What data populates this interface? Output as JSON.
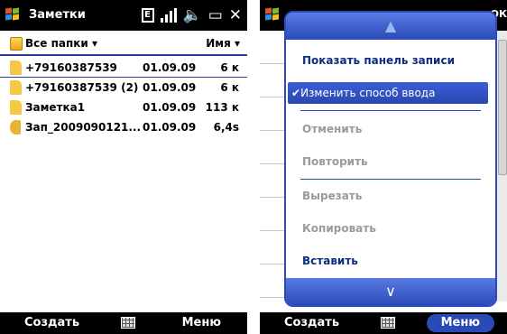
{
  "left_screen": {
    "app_title": "Заметки",
    "status_icons": [
      "edge-icon",
      "signal-icon",
      "volume-icon",
      "battery-icon",
      "close-icon"
    ],
    "status_e": "E",
    "folder": {
      "label": "Все папки",
      "sort_label": "Имя"
    },
    "files": [
      {
        "name": "+79160387539",
        "date": "01.09.09",
        "size": "6 к",
        "icon": "note-file-icon"
      },
      {
        "name": "+79160387539 (2)",
        "date": "01.09.09",
        "size": "6 к",
        "icon": "note-file-icon"
      },
      {
        "name": "Заметка1",
        "date": "01.09.09",
        "size": "113 к",
        "icon": "note-file-icon"
      },
      {
        "name": "Зап_2009090121...",
        "date": "01.09.09",
        "size": "6,4s",
        "icon": "sound-file-icon"
      }
    ],
    "softkeys": {
      "left": "Создать",
      "right": "Меню"
    }
  },
  "right_screen": {
    "ok_label": "ОК",
    "menu_items": [
      {
        "label": "Показать панель записи",
        "state": "enabled"
      },
      {
        "label": "Изменить способ ввода",
        "state": "selected",
        "checked": true
      },
      {
        "label": "Отменить",
        "state": "disabled"
      },
      {
        "label": "Повторить",
        "state": "disabled"
      },
      {
        "label": "Вырезать",
        "state": "disabled"
      },
      {
        "label": "Копировать",
        "state": "disabled"
      },
      {
        "label": "Вставить",
        "state": "enabled"
      }
    ],
    "softkeys": {
      "left": "Создать",
      "right": "Меню"
    }
  },
  "colors": {
    "accent": "#2a4ab8",
    "menu_text": "#0b2e80",
    "disabled_text": "#9a9a9a",
    "bar_background": "#000000"
  }
}
